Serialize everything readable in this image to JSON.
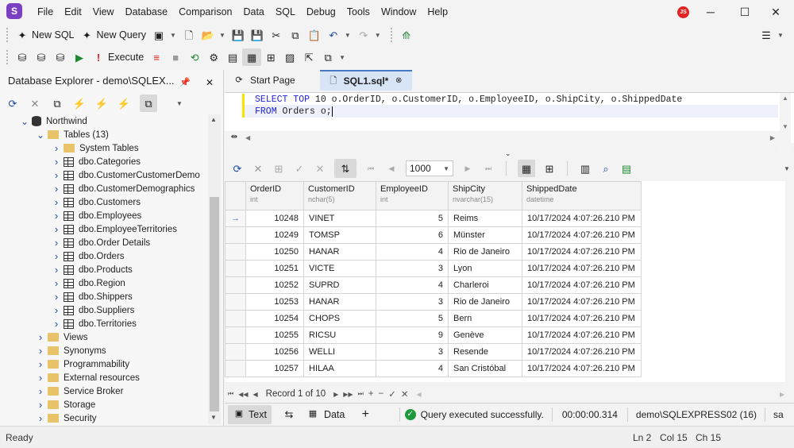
{
  "app": {
    "logo_letter": "S",
    "user_initials": "JS"
  },
  "menu": [
    "File",
    "Edit",
    "View",
    "Database",
    "Comparison",
    "Data",
    "SQL",
    "Debug",
    "Tools",
    "Window",
    "Help"
  ],
  "window_controls": {
    "minimize": "─",
    "maximize": "☐",
    "close": "✕"
  },
  "toolbar1": {
    "new_sql": "New SQL",
    "new_query": "New Query"
  },
  "toolbar2": {
    "execute": "Execute"
  },
  "explorer": {
    "title": "Database Explorer - demo\\SQLEX...",
    "tree": [
      {
        "label": "Northwind",
        "depth": 0,
        "icon": "database",
        "expanded": true
      },
      {
        "label": "Tables (13)",
        "depth": 1,
        "icon": "folder",
        "expanded": true
      },
      {
        "label": "System Tables",
        "depth": 2,
        "icon": "folder"
      },
      {
        "label": "dbo.Categories",
        "depth": 2,
        "icon": "table"
      },
      {
        "label": "dbo.CustomerCustomerDemo",
        "depth": 2,
        "icon": "table"
      },
      {
        "label": "dbo.CustomerDemographics",
        "depth": 2,
        "icon": "table"
      },
      {
        "label": "dbo.Customers",
        "depth": 2,
        "icon": "table"
      },
      {
        "label": "dbo.Employees",
        "depth": 2,
        "icon": "table"
      },
      {
        "label": "dbo.EmployeeTerritories",
        "depth": 2,
        "icon": "table"
      },
      {
        "label": "dbo.Order Details",
        "depth": 2,
        "icon": "table"
      },
      {
        "label": "dbo.Orders",
        "depth": 2,
        "icon": "table"
      },
      {
        "label": "dbo.Products",
        "depth": 2,
        "icon": "table"
      },
      {
        "label": "dbo.Region",
        "depth": 2,
        "icon": "table"
      },
      {
        "label": "dbo.Shippers",
        "depth": 2,
        "icon": "table"
      },
      {
        "label": "dbo.Suppliers",
        "depth": 2,
        "icon": "table"
      },
      {
        "label": "dbo.Territories",
        "depth": 2,
        "icon": "table"
      },
      {
        "label": "Views",
        "depth": 1,
        "icon": "folder"
      },
      {
        "label": "Synonyms",
        "depth": 1,
        "icon": "folder"
      },
      {
        "label": "Programmability",
        "depth": 1,
        "icon": "folder"
      },
      {
        "label": "External resources",
        "depth": 1,
        "icon": "folder"
      },
      {
        "label": "Service Broker",
        "depth": 1,
        "icon": "folder"
      },
      {
        "label": "Storage",
        "depth": 1,
        "icon": "folder"
      },
      {
        "label": "Security",
        "depth": 1,
        "icon": "folder"
      }
    ]
  },
  "tabs": [
    {
      "label": "Start Page",
      "active": false
    },
    {
      "label": "SQL1.sql*",
      "active": true
    }
  ],
  "editor": {
    "line1_kw": "SELECT TOP",
    "line1_rest": " 10 o.OrderID, o.CustomerID, o.EmployeeID, o.ShipCity, o.ShippedDate",
    "line2_kw": "FROM",
    "line2_rest": " Orders o;"
  },
  "grid_toolbar": {
    "page_size": "1000"
  },
  "grid": {
    "columns": [
      {
        "name": "OrderID",
        "type": "int"
      },
      {
        "name": "CustomerID",
        "type": "nchar(5)"
      },
      {
        "name": "EmployeeID",
        "type": "int"
      },
      {
        "name": "ShipCity",
        "type": "nvarchar(15)"
      },
      {
        "name": "ShippedDate",
        "type": "datetime"
      }
    ],
    "rows": [
      [
        "10248",
        "VINET",
        "5",
        "Reims",
        "10/17/2024 4:07:26.210 PM"
      ],
      [
        "10249",
        "TOMSP",
        "6",
        "Münster",
        "10/17/2024 4:07:26.210 PM"
      ],
      [
        "10250",
        "HANAR",
        "4",
        "Rio de Janeiro",
        "10/17/2024 4:07:26.210 PM"
      ],
      [
        "10251",
        "VICTE",
        "3",
        "Lyon",
        "10/17/2024 4:07:26.210 PM"
      ],
      [
        "10252",
        "SUPRD",
        "4",
        "Charleroi",
        "10/17/2024 4:07:26.210 PM"
      ],
      [
        "10253",
        "HANAR",
        "3",
        "Rio de Janeiro",
        "10/17/2024 4:07:26.210 PM"
      ],
      [
        "10254",
        "CHOPS",
        "5",
        "Bern",
        "10/17/2024 4:07:26.210 PM"
      ],
      [
        "10255",
        "RICSU",
        "9",
        "Genève",
        "10/17/2024 4:07:26.210 PM"
      ],
      [
        "10256",
        "WELLI",
        "3",
        "Resende",
        "10/17/2024 4:07:26.210 PM"
      ],
      [
        "10257",
        "HILAA",
        "4",
        "San Cristóbal",
        "10/17/2024 4:07:26.210 PM"
      ]
    ],
    "current_row_marker": "→"
  },
  "record_nav": {
    "label": "Record 1 of 10"
  },
  "doc_bar": {
    "text_tab": "Text",
    "data_tab": "Data",
    "status": "Query executed successfully.",
    "elapsed": "00:00:00.314",
    "connection": "demo\\SQLEXPRESS02 (16)",
    "user": "sa"
  },
  "statusbar": {
    "state": "Ready",
    "ln": "Ln 2",
    "col": "Col 15",
    "ch": "Ch 15"
  }
}
